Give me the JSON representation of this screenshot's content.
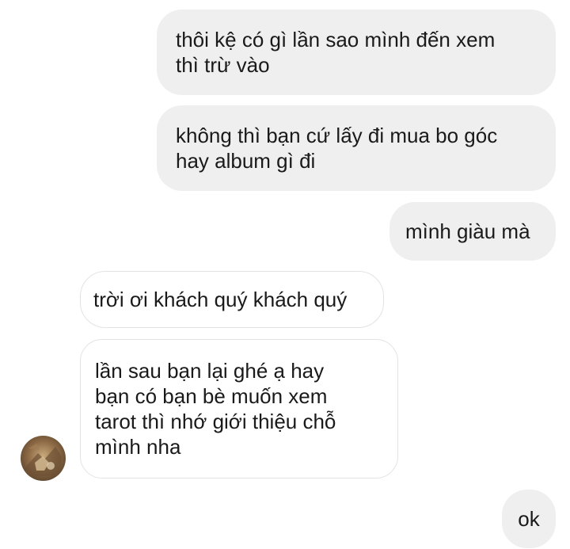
{
  "conversation": {
    "messages": [
      {
        "sender": "me",
        "text": "thôi kệ có gì lần sao mình đến xem\nthì trừ vào"
      },
      {
        "sender": "me",
        "text": "không thì bạn cứ lấy đi mua bo góc\nhay album gì đi"
      },
      {
        "sender": "me",
        "text": "mình giàu mà"
      },
      {
        "sender": "other",
        "text": "trời ơi khách quý khách quý"
      },
      {
        "sender": "other",
        "text": "lần sau bạn lại ghé ạ hay\nbạn có bạn bè muốn xem\ntarot thì nhớ giới thiệu chỗ\nmình nha"
      },
      {
        "sender": "me",
        "text": "ok"
      }
    ]
  },
  "colors": {
    "sent_bubble": "#efefef",
    "received_bubble_border": "#e3e3e3",
    "text": "#1a1a1a",
    "background": "#ffffff"
  }
}
